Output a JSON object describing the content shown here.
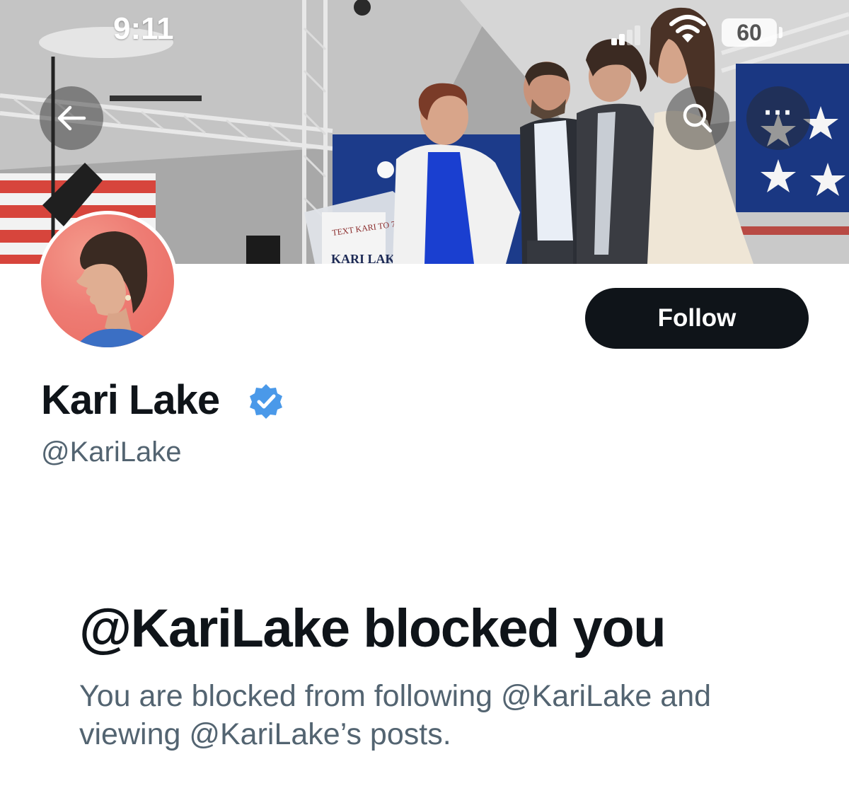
{
  "status_bar": {
    "time": "9:11",
    "battery": "60"
  },
  "header": {
    "back_icon": "arrow-left-icon",
    "search_icon": "search-icon",
    "more_icon": "more-horizontal-icon"
  },
  "profile": {
    "display_name": "Kari Lake",
    "handle": "@KariLake",
    "verified": true,
    "verified_color": "#4a99e9",
    "follow_label": "Follow",
    "banner_podium_text": "KARI LAKE"
  },
  "blocked": {
    "title": "@KariLake blocked you",
    "description": "You are blocked from following @KariLake and viewing @KariLake’s posts."
  },
  "colors": {
    "primary_text": "#0f1419",
    "secondary_text": "#536471",
    "follow_button_bg": "#0f1419",
    "follow_button_text": "#ffffff"
  }
}
